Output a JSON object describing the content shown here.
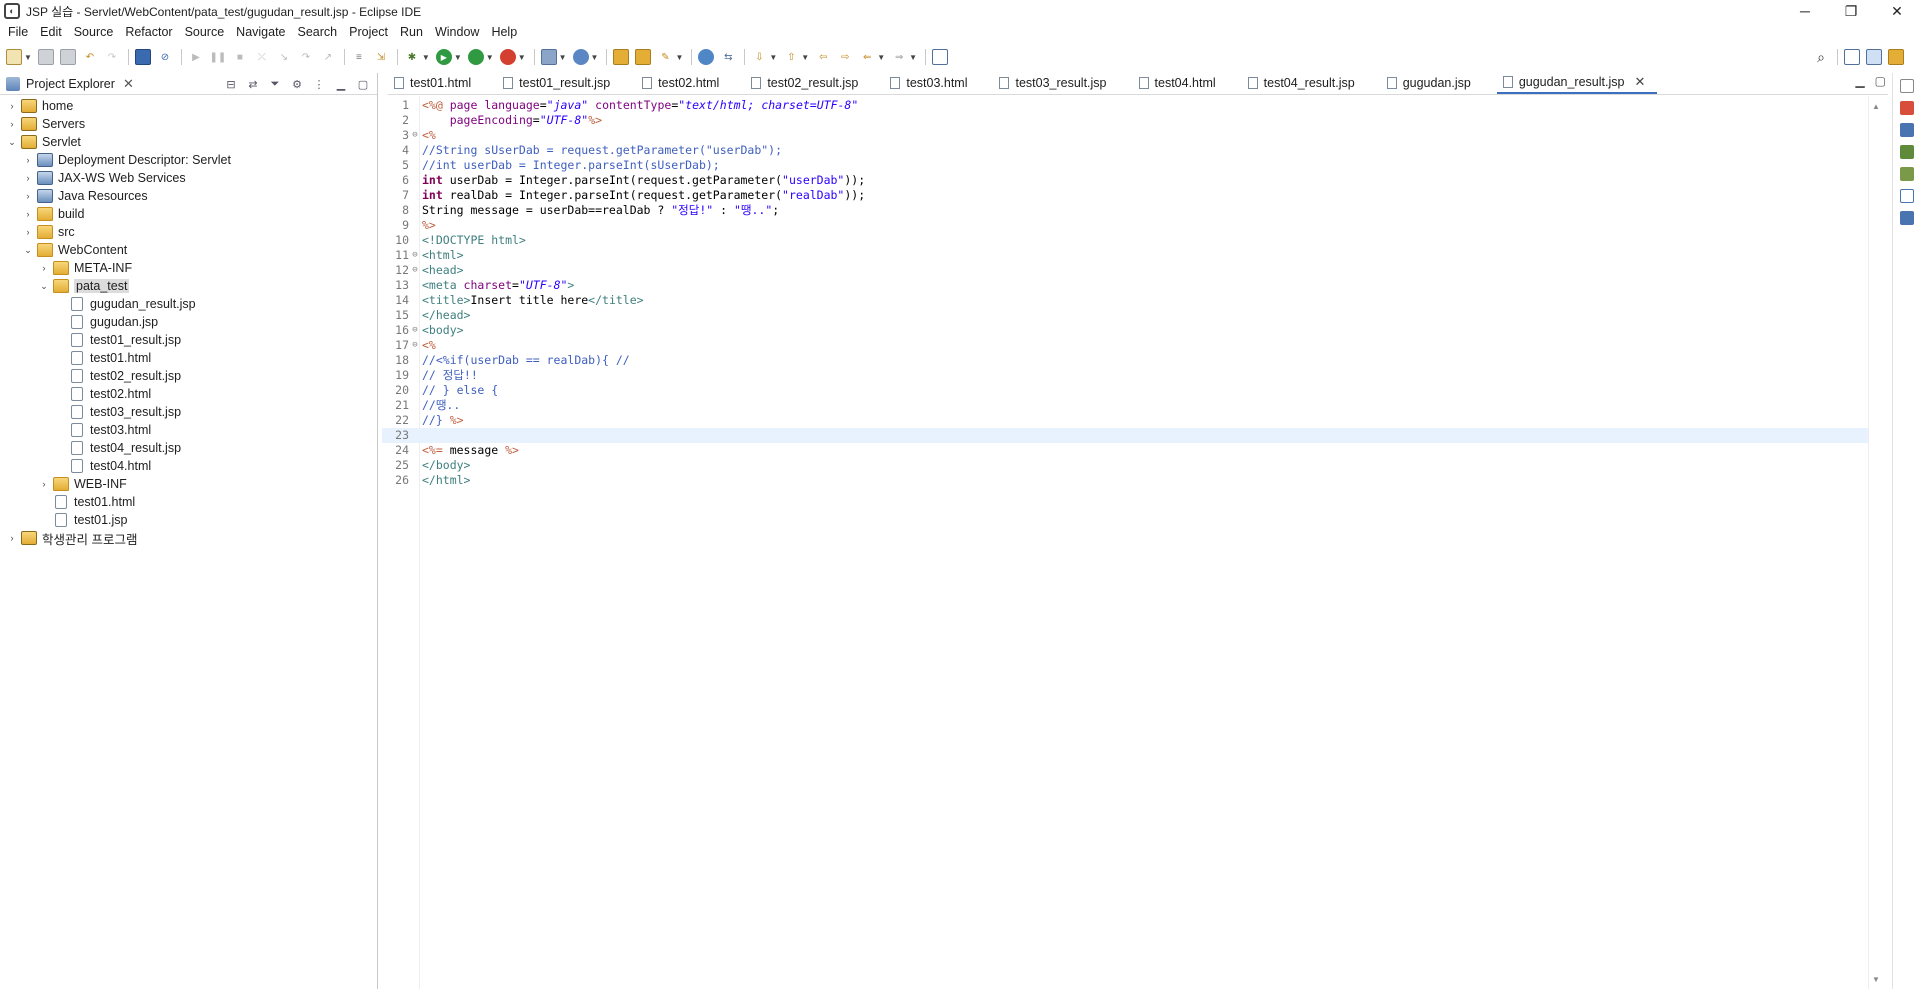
{
  "window": {
    "title": "JSP 실습 - Servlet/WebContent/pata_test/gugudan_result.jsp - Eclipse IDE",
    "controls": [
      "─",
      "❐",
      "✕"
    ]
  },
  "menu": [
    "File",
    "Edit",
    "Source",
    "Refactor",
    "Source",
    "Navigate",
    "Search",
    "Project",
    "Run",
    "Window",
    "Help"
  ],
  "explorer": {
    "title": "Project Explorer",
    "tree": [
      {
        "label": "home",
        "depth": 0,
        "twisty": "›",
        "icon": "project"
      },
      {
        "label": "Servers",
        "depth": 0,
        "twisty": "›",
        "icon": "project"
      },
      {
        "label": "Servlet",
        "depth": 0,
        "twisty": "⌄",
        "icon": "project"
      },
      {
        "label": "Deployment Descriptor: Servlet",
        "depth": 1,
        "twisty": "›",
        "icon": "special"
      },
      {
        "label": "JAX-WS Web Services",
        "depth": 1,
        "twisty": "›",
        "icon": "special"
      },
      {
        "label": "Java Resources",
        "depth": 1,
        "twisty": "›",
        "icon": "special"
      },
      {
        "label": "build",
        "depth": 1,
        "twisty": "›",
        "icon": "folder"
      },
      {
        "label": "src",
        "depth": 1,
        "twisty": "›",
        "icon": "folder"
      },
      {
        "label": "WebContent",
        "depth": 1,
        "twisty": "⌄",
        "icon": "folder"
      },
      {
        "label": "META-INF",
        "depth": 2,
        "twisty": "›",
        "icon": "folder"
      },
      {
        "label": "pata_test",
        "depth": 2,
        "twisty": "⌄",
        "icon": "folder",
        "selected": true
      },
      {
        "label": "gugudan_result.jsp",
        "depth": 3,
        "twisty": "",
        "icon": "file"
      },
      {
        "label": "gugudan.jsp",
        "depth": 3,
        "twisty": "",
        "icon": "file"
      },
      {
        "label": "test01_result.jsp",
        "depth": 3,
        "twisty": "",
        "icon": "file"
      },
      {
        "label": "test01.html",
        "depth": 3,
        "twisty": "",
        "icon": "file"
      },
      {
        "label": "test02_result.jsp",
        "depth": 3,
        "twisty": "",
        "icon": "file"
      },
      {
        "label": "test02.html",
        "depth": 3,
        "twisty": "",
        "icon": "file"
      },
      {
        "label": "test03_result.jsp",
        "depth": 3,
        "twisty": "",
        "icon": "file"
      },
      {
        "label": "test03.html",
        "depth": 3,
        "twisty": "",
        "icon": "file"
      },
      {
        "label": "test04_result.jsp",
        "depth": 3,
        "twisty": "",
        "icon": "file"
      },
      {
        "label": "test04.html",
        "depth": 3,
        "twisty": "",
        "icon": "file"
      },
      {
        "label": "WEB-INF",
        "depth": 2,
        "twisty": "›",
        "icon": "folder"
      },
      {
        "label": "test01.html",
        "depth": 2,
        "twisty": "",
        "icon": "file"
      },
      {
        "label": "test01.jsp",
        "depth": 2,
        "twisty": "",
        "icon": "file"
      },
      {
        "label": "학생관리 프로그램",
        "depth": 0,
        "twisty": "›",
        "icon": "project"
      }
    ]
  },
  "tabs": [
    {
      "label": "test01.html",
      "active": false
    },
    {
      "label": "test01_result.jsp",
      "active": false
    },
    {
      "label": "test02.html",
      "active": false
    },
    {
      "label": "test02_result.jsp",
      "active": false
    },
    {
      "label": "test03.html",
      "active": false
    },
    {
      "label": "test03_result.jsp",
      "active": false
    },
    {
      "label": "test04.html",
      "active": false
    },
    {
      "label": "test04_result.jsp",
      "active": false
    },
    {
      "label": "gugudan.jsp",
      "active": false
    },
    {
      "label": "gugudan_result.jsp",
      "active": true
    }
  ],
  "code": [
    {
      "n": "1",
      "fold": "",
      "segs": [
        [
          "c-delim",
          "<%@ "
        ],
        [
          "c-attr",
          "page "
        ],
        [
          "c-attr",
          "language"
        ],
        [
          "c-plain",
          "="
        ],
        [
          "c-str",
          "\"java\""
        ],
        [
          "c-plain",
          " "
        ],
        [
          "c-attr",
          "contentType"
        ],
        [
          "c-plain",
          "="
        ],
        [
          "c-str",
          "\"text/html; charset=UTF-8\""
        ]
      ]
    },
    {
      "n": "2",
      "fold": "",
      "segs": [
        [
          "c-plain",
          "    "
        ],
        [
          "c-attr",
          "pageEncoding"
        ],
        [
          "c-plain",
          "="
        ],
        [
          "c-str",
          "\"UTF-8\""
        ],
        [
          "c-delim",
          "%>"
        ]
      ]
    },
    {
      "n": "3",
      "fold": "⊖",
      "segs": [
        [
          "c-delim",
          "<%"
        ]
      ]
    },
    {
      "n": "4",
      "fold": "",
      "segs": [
        [
          "c-comment",
          "//String sUserDab = request.getParameter(\"userDab\");"
        ]
      ]
    },
    {
      "n": "5",
      "fold": "",
      "segs": [
        [
          "c-comment",
          "//int userDab = Integer.parseInt(sUserDab);"
        ]
      ]
    },
    {
      "n": "6",
      "fold": "",
      "segs": [
        [
          "c-kw",
          "int"
        ],
        [
          "c-plain",
          " userDab = Integer.parseInt(request.getParameter("
        ],
        [
          "c-jstr",
          "\"userDab\""
        ],
        [
          "c-plain",
          "));"
        ]
      ]
    },
    {
      "n": "7",
      "fold": "",
      "segs": [
        [
          "c-kw",
          "int"
        ],
        [
          "c-plain",
          " realDab = Integer.parseInt(request.getParameter("
        ],
        [
          "c-jstr",
          "\"realDab\""
        ],
        [
          "c-plain",
          "));"
        ]
      ]
    },
    {
      "n": "8",
      "fold": "",
      "segs": [
        [
          "c-plain",
          "String message = userDab==realDab ? "
        ],
        [
          "c-jstr",
          "\"정답!\""
        ],
        [
          "c-plain",
          " : "
        ],
        [
          "c-jstr",
          "\"땡..\""
        ],
        [
          "c-plain",
          ";"
        ]
      ]
    },
    {
      "n": "9",
      "fold": "",
      "segs": [
        [
          "c-delim",
          "%>"
        ]
      ]
    },
    {
      "n": "10",
      "fold": "",
      "segs": [
        [
          "c-tag",
          "<!DOCTYPE html>"
        ]
      ]
    },
    {
      "n": "11",
      "fold": "⊖",
      "segs": [
        [
          "c-tag",
          "<html>"
        ]
      ]
    },
    {
      "n": "12",
      "fold": "⊖",
      "segs": [
        [
          "c-tag",
          "<head>"
        ]
      ]
    },
    {
      "n": "13",
      "fold": "",
      "segs": [
        [
          "c-tag",
          "<meta "
        ],
        [
          "c-attr",
          "charset"
        ],
        [
          "c-plain",
          "="
        ],
        [
          "c-str",
          "\"UTF-8\""
        ],
        [
          "c-tag",
          ">"
        ]
      ]
    },
    {
      "n": "14",
      "fold": "",
      "segs": [
        [
          "c-tag",
          "<title>"
        ],
        [
          "c-plain",
          "Insert title here"
        ],
        [
          "c-tag",
          "</title>"
        ]
      ]
    },
    {
      "n": "15",
      "fold": "",
      "segs": [
        [
          "c-tag",
          "</head>"
        ]
      ]
    },
    {
      "n": "16",
      "fold": "⊖",
      "segs": [
        [
          "c-tag",
          "<body>"
        ]
      ]
    },
    {
      "n": "17",
      "fold": "⊖",
      "segs": [
        [
          "c-delim",
          "<%"
        ]
      ]
    },
    {
      "n": "18",
      "fold": "",
      "segs": [
        [
          "c-comment",
          "//<%if(userDab == realDab){ //"
        ]
      ]
    },
    {
      "n": "19",
      "fold": "",
      "segs": [
        [
          "c-comment",
          "// 정답!!"
        ]
      ]
    },
    {
      "n": "20",
      "fold": "",
      "segs": [
        [
          "c-comment",
          "// } else {"
        ]
      ]
    },
    {
      "n": "21",
      "fold": "",
      "segs": [
        [
          "c-comment",
          "//땡.."
        ]
      ]
    },
    {
      "n": "22",
      "fold": "",
      "segs": [
        [
          "c-comment",
          "//} "
        ],
        [
          "c-delim",
          "%>"
        ]
      ]
    },
    {
      "n": "23",
      "fold": "",
      "segs": [
        [
          "c-plain",
          ""
        ]
      ],
      "current": true
    },
    {
      "n": "24",
      "fold": "",
      "segs": [
        [
          "c-delim",
          "<%="
        ],
        [
          "c-plain",
          " message "
        ],
        [
          "c-delim",
          "%>"
        ]
      ]
    },
    {
      "n": "25",
      "fold": "",
      "segs": [
        [
          "c-tag",
          "</body>"
        ]
      ]
    },
    {
      "n": "26",
      "fold": "",
      "segs": [
        [
          "c-tag",
          "</html>"
        ]
      ]
    }
  ],
  "colors": {
    "accent": "#3b6fc4",
    "current_line": "#e8f2fe",
    "selection": "#dcdcdc"
  },
  "toolbar_icons": [
    "new-icon",
    "save-icon",
    "save-all-icon",
    "undo-icon",
    "redo-icon",
    "console-icon",
    "skip-breakpoints-icon",
    "resume-icon",
    "suspend-icon",
    "terminate-icon",
    "disconnect-icon",
    "step-into-icon",
    "step-over-icon",
    "step-return-icon",
    "use-step-filters-icon",
    "drop-to-frame-icon",
    "debug-icon",
    "run-icon",
    "coverage-icon",
    "run-external-icon",
    "new-server-icon",
    "new-wizard-icon",
    "open-type-icon",
    "open-task-icon",
    "search-icon-tb",
    "globe-icon",
    "java-browsing-icon",
    "annotation-next-icon",
    "annotation-prev-icon",
    "back-icon",
    "forward-icon",
    "pin-editor-icon"
  ]
}
